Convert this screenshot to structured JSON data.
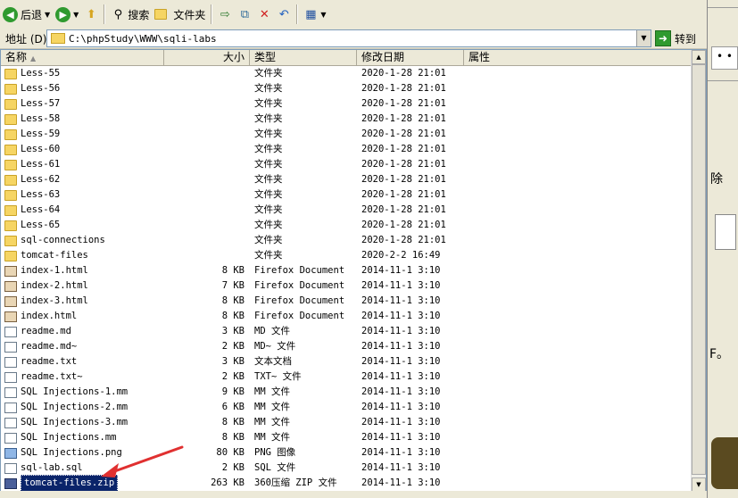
{
  "toolbar": {
    "back_label": "后退",
    "search_label": "搜索",
    "folders_label": "文件夹"
  },
  "address": {
    "label": "地址 (D)",
    "path": "C:\\phpStudy\\WWW\\sqli-labs",
    "go_label": "转到"
  },
  "columns": {
    "name": "名称",
    "size": "大小",
    "type": "类型",
    "date": "修改日期",
    "attr": "属性"
  },
  "files": [
    {
      "name": "Less-55",
      "size": "",
      "type": "文件夹",
      "date": "2020-1-28 21:01",
      "icon": "folder"
    },
    {
      "name": "Less-56",
      "size": "",
      "type": "文件夹",
      "date": "2020-1-28 21:01",
      "icon": "folder"
    },
    {
      "name": "Less-57",
      "size": "",
      "type": "文件夹",
      "date": "2020-1-28 21:01",
      "icon": "folder"
    },
    {
      "name": "Less-58",
      "size": "",
      "type": "文件夹",
      "date": "2020-1-28 21:01",
      "icon": "folder"
    },
    {
      "name": "Less-59",
      "size": "",
      "type": "文件夹",
      "date": "2020-1-28 21:01",
      "icon": "folder"
    },
    {
      "name": "Less-60",
      "size": "",
      "type": "文件夹",
      "date": "2020-1-28 21:01",
      "icon": "folder"
    },
    {
      "name": "Less-61",
      "size": "",
      "type": "文件夹",
      "date": "2020-1-28 21:01",
      "icon": "folder"
    },
    {
      "name": "Less-62",
      "size": "",
      "type": "文件夹",
      "date": "2020-1-28 21:01",
      "icon": "folder"
    },
    {
      "name": "Less-63",
      "size": "",
      "type": "文件夹",
      "date": "2020-1-28 21:01",
      "icon": "folder"
    },
    {
      "name": "Less-64",
      "size": "",
      "type": "文件夹",
      "date": "2020-1-28 21:01",
      "icon": "folder"
    },
    {
      "name": "Less-65",
      "size": "",
      "type": "文件夹",
      "date": "2020-1-28 21:01",
      "icon": "folder"
    },
    {
      "name": "sql-connections",
      "size": "",
      "type": "文件夹",
      "date": "2020-1-28 21:01",
      "icon": "folder"
    },
    {
      "name": "tomcat-files",
      "size": "",
      "type": "文件夹",
      "date": "2020-2-2 16:49",
      "icon": "folder"
    },
    {
      "name": "index-1.html",
      "size": "8 KB",
      "type": "Firefox Document",
      "date": "2014-11-1 3:10",
      "icon": "html"
    },
    {
      "name": "index-2.html",
      "size": "7 KB",
      "type": "Firefox Document",
      "date": "2014-11-1 3:10",
      "icon": "html"
    },
    {
      "name": "index-3.html",
      "size": "8 KB",
      "type": "Firefox Document",
      "date": "2014-11-1 3:10",
      "icon": "html"
    },
    {
      "name": "index.html",
      "size": "8 KB",
      "type": "Firefox Document",
      "date": "2014-11-1 3:10",
      "icon": "html"
    },
    {
      "name": "readme.md",
      "size": "3 KB",
      "type": "MD 文件",
      "date": "2014-11-1 3:10",
      "icon": "doc"
    },
    {
      "name": "readme.md~",
      "size": "2 KB",
      "type": "MD~ 文件",
      "date": "2014-11-1 3:10",
      "icon": "doc"
    },
    {
      "name": "readme.txt",
      "size": "3 KB",
      "type": "文本文档",
      "date": "2014-11-1 3:10",
      "icon": "doc"
    },
    {
      "name": "readme.txt~",
      "size": "2 KB",
      "type": "TXT~ 文件",
      "date": "2014-11-1 3:10",
      "icon": "doc"
    },
    {
      "name": "SQL Injections-1.mm",
      "size": "9 KB",
      "type": "MM 文件",
      "date": "2014-11-1 3:10",
      "icon": "doc"
    },
    {
      "name": "SQL Injections-2.mm",
      "size": "6 KB",
      "type": "MM 文件",
      "date": "2014-11-1 3:10",
      "icon": "doc"
    },
    {
      "name": "SQL Injections-3.mm",
      "size": "8 KB",
      "type": "MM 文件",
      "date": "2014-11-1 3:10",
      "icon": "doc"
    },
    {
      "name": "SQL Injections.mm",
      "size": "8 KB",
      "type": "MM 文件",
      "date": "2014-11-1 3:10",
      "icon": "doc"
    },
    {
      "name": "SQL Injections.png",
      "size": "80 KB",
      "type": "PNG 图像",
      "date": "2014-11-1 3:10",
      "icon": "png"
    },
    {
      "name": "sql-lab.sql",
      "size": "2 KB",
      "type": "SQL 文件",
      "date": "2014-11-1 3:10",
      "icon": "doc"
    },
    {
      "name": "tomcat-files.zip",
      "size": "263 KB",
      "type": "360压缩 ZIP 文件",
      "date": "2014-11-1 3:10",
      "icon": "zip",
      "selected": true
    }
  ],
  "side": {
    "delete_text": "除",
    "fragment_text": "F。"
  },
  "colors": {
    "selection": "#0a246a",
    "annotation_arrow": "#e03030"
  }
}
